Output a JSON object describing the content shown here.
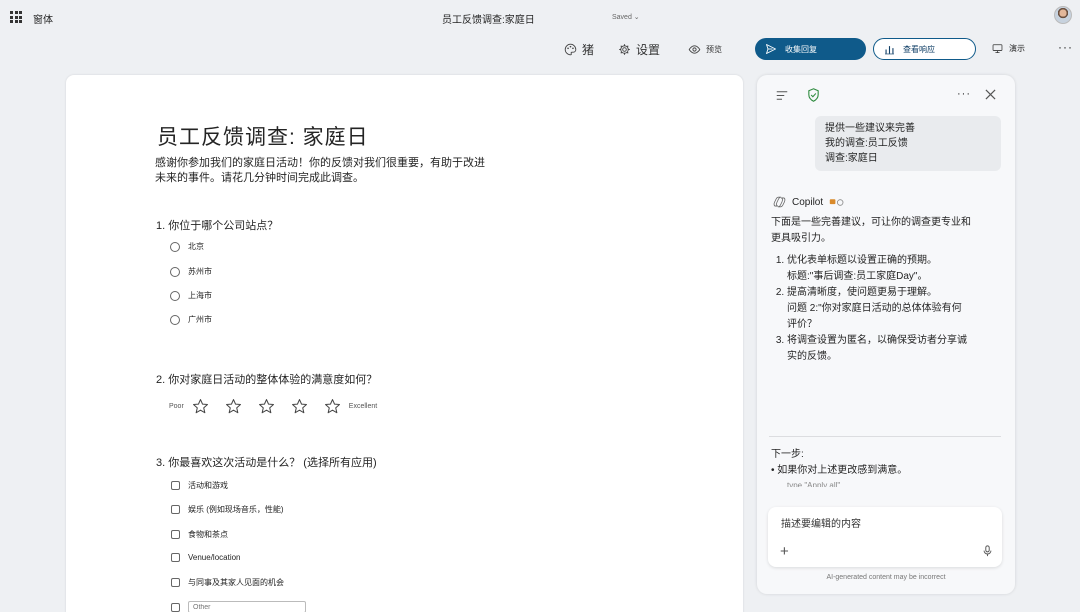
{
  "topbar": {
    "app_name": "窗体",
    "doc_title": "员工反馈调查:家庭日",
    "saved": "Saved ⌄"
  },
  "toolbar": {
    "theme_label": "猪",
    "settings_label": "设置",
    "preview_label": "预览",
    "collect_label": "收集回复",
    "view_responses_label": "查看响应",
    "present_label": "演示",
    "more_label": "···"
  },
  "form": {
    "title": "员工反馈调查: 家庭日",
    "description": "感谢你参加我们的家庭日活动！你的反馈对我们很重要，有助于改进未来的事件。请花几分钟时间完成此调查。",
    "q1": {
      "title": "1. 你位于哪个公司站点？",
      "options": [
        "北京",
        "苏州市",
        "上海市",
        "广州市"
      ]
    },
    "q2": {
      "title": "2. 你对家庭日活动的整体体验的满意度如何？",
      "low_label": "Poor",
      "high_label": "Excellent",
      "rating_max": 5
    },
    "q3": {
      "title": "3. 你最喜欢这次活动是什么？ (选择所有应用)",
      "options": [
        "活动和游戏",
        "娱乐 (例如现场音乐，性能)",
        "食物和茶点",
        "Venue/location",
        "与同事及其家人见面的机会"
      ],
      "other_placeholder": "Other"
    }
  },
  "copilot": {
    "user_message": [
      "提供一些建议来完善",
      "我的调查:员工反馈",
      "调查:家庭日"
    ],
    "name": "Copilot",
    "intro": "下面是一些完善建议，可让你的调查更专业和更具吸引力。",
    "suggestions": [
      {
        "main": "优化表单标题以设置正确的预期。",
        "detail": "标题:\"事后调查:员工家庭Day\"。"
      },
      {
        "main": "提高清晰度，使问题更易于理解。",
        "detail": "问题 2:\"你对家庭日活动的总体体验有何评价？"
      },
      {
        "main": "将调查设置为匿名，以确保受访者分享诚实的反馈。",
        "detail": ""
      }
    ],
    "next_steps_title": "下一步:",
    "next_step_item": "如果你对上述更改感到满意。",
    "next_step_cut": "type \"Apply all\"",
    "composer_placeholder": "描述要编辑的内容",
    "disclaimer": "AI-generated content may be incorrect"
  },
  "colors": {
    "primary": "#0f5a8a",
    "canvas": "#eef0f3",
    "card": "#ffffff",
    "shield": "#2e8b3e"
  }
}
